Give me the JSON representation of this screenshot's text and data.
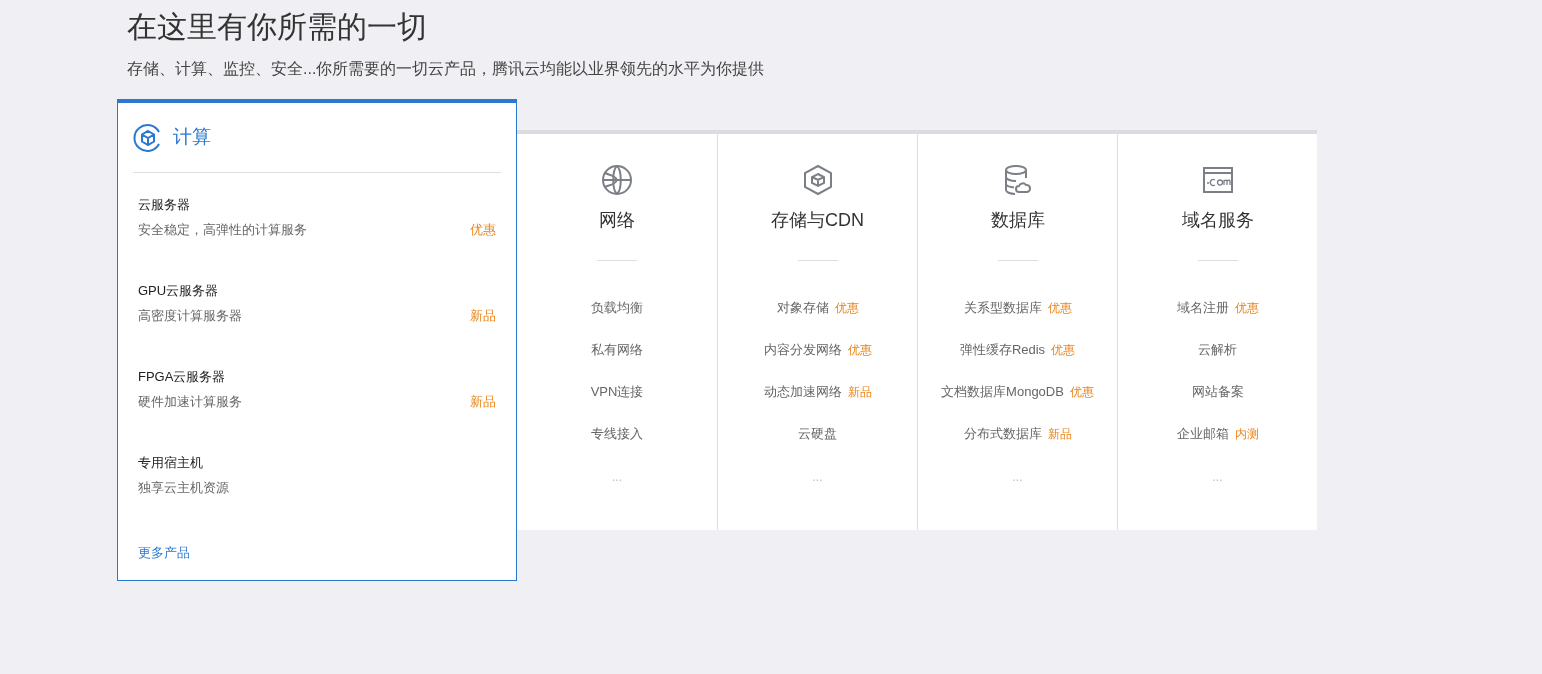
{
  "heading": "在这里有你所需的一切",
  "subheading": "存储、计算、监控、安全...你所需要的一切云产品，腾讯云均能以业界领先的水平为你提供",
  "featured": {
    "title": "计算",
    "items": [
      {
        "name": "云服务器",
        "description": "安全稳定，高弹性的计算服务",
        "tag": "优惠"
      },
      {
        "name": "GPU云服务器",
        "description": "高密度计算服务器",
        "tag": "新品"
      },
      {
        "name": "FPGA云服务器",
        "description": "硬件加速计算服务",
        "tag": "新品"
      },
      {
        "name": "专用宿主机",
        "description": "独享云主机资源"
      }
    ],
    "more": "更多产品"
  },
  "categories": [
    {
      "kind": "globe",
      "title": "网络",
      "items": [
        {
          "name": "负载均衡"
        },
        {
          "name": "私有网络"
        },
        {
          "name": "VPN连接"
        },
        {
          "name": "专线接入"
        }
      ],
      "more": "..."
    },
    {
      "kind": "cube",
      "title": "存储与CDN",
      "items": [
        {
          "name": "对象存储",
          "tag": "优惠"
        },
        {
          "name": "内容分发网络",
          "tag": "优惠"
        },
        {
          "name": "动态加速网络",
          "tag": "新品"
        },
        {
          "name": "云硬盘"
        }
      ],
      "more": "..."
    },
    {
      "kind": "database",
      "title": "数据库",
      "items": [
        {
          "name": "关系型数据库",
          "tag": "优惠"
        },
        {
          "name": "弹性缓存Redis",
          "tag": "优惠"
        },
        {
          "name": "文档数据库MongoDB",
          "tag": "优惠"
        },
        {
          "name": "分布式数据库",
          "tag": "新品"
        }
      ],
      "more": "..."
    },
    {
      "kind": "domain",
      "title": "域名服务",
      "items": [
        {
          "name": "域名注册",
          "tag": "优惠"
        },
        {
          "name": "云解析"
        },
        {
          "name": "网站备案"
        },
        {
          "name": "企业邮箱",
          "tag": "内测"
        }
      ],
      "more": "..."
    }
  ]
}
